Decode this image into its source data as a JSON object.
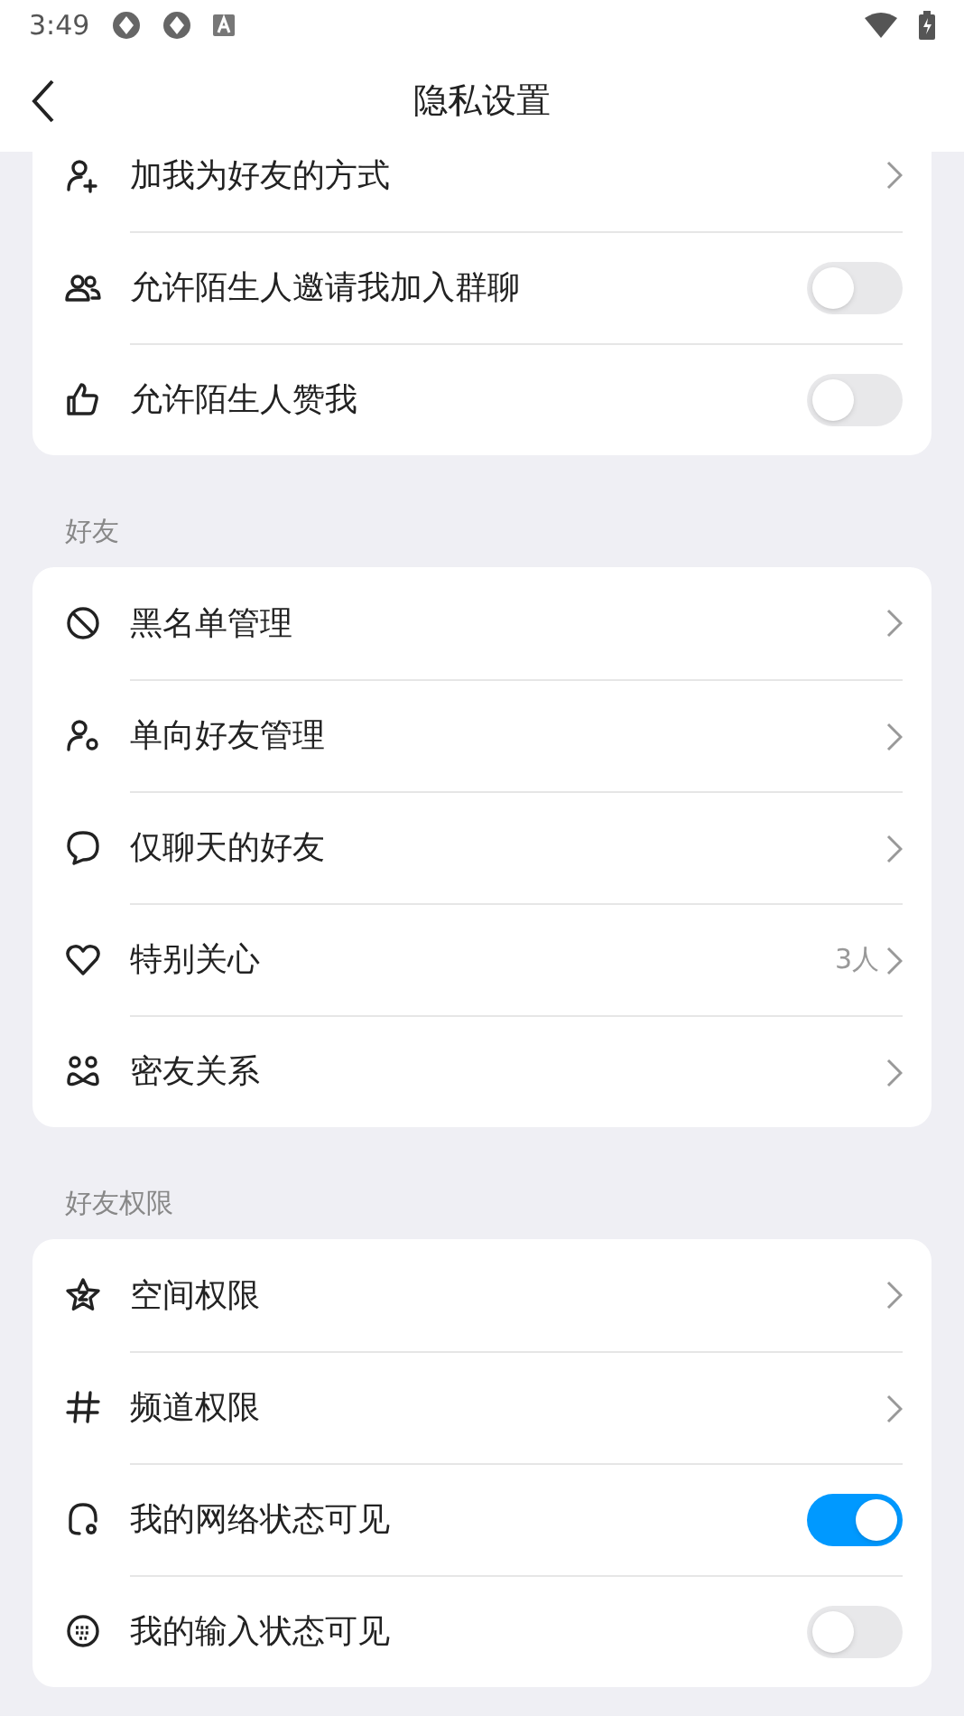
{
  "status_bar": {
    "time": "3:49"
  },
  "header": {
    "title": "隐私设置"
  },
  "sections": [
    {
      "rows": [
        {
          "kind": "link",
          "label": "加我为好友的方式"
        },
        {
          "kind": "toggle",
          "label": "允许陌生人邀请我加入群聊",
          "on": false
        },
        {
          "kind": "toggle",
          "label": "允许陌生人赞我",
          "on": false
        }
      ]
    },
    {
      "title": "好友",
      "rows": [
        {
          "kind": "link",
          "label": "黑名单管理"
        },
        {
          "kind": "link",
          "label": "单向好友管理"
        },
        {
          "kind": "link",
          "label": "仅聊天的好友"
        },
        {
          "kind": "link",
          "label": "特别关心",
          "value": "3人"
        },
        {
          "kind": "link",
          "label": "密友关系"
        }
      ]
    },
    {
      "title": "好友权限",
      "rows": [
        {
          "kind": "link",
          "label": "空间权限"
        },
        {
          "kind": "link",
          "label": "频道权限"
        },
        {
          "kind": "toggle",
          "label": "我的网络状态可见",
          "on": true
        },
        {
          "kind": "toggle",
          "label": "我的输入状态可见",
          "on": false
        }
      ]
    }
  ]
}
